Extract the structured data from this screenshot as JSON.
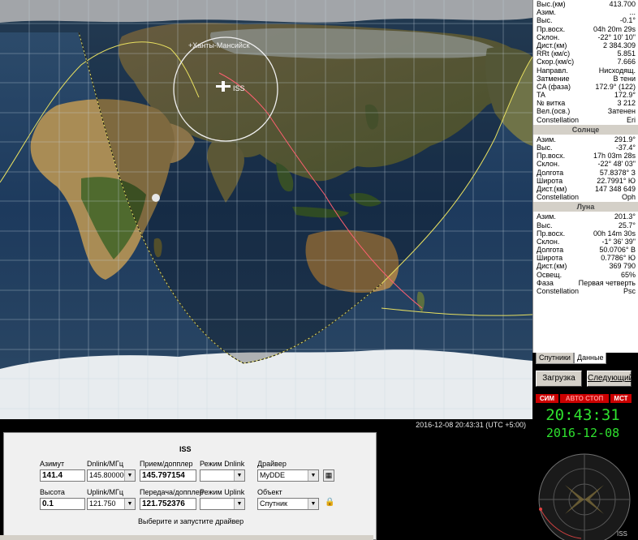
{
  "map": {
    "status": "2016-12-08 20:43:31 (UTC +5:00)",
    "sat_label": "ISS",
    "city_label": "+Ханты-Мансийск"
  },
  "info_main": [
    [
      "Выс.(км)",
      "413.700"
    ],
    [
      "Азим.",
      "..."
    ],
    [
      "Выс.",
      "-0.1°"
    ],
    [
      "Пр.восх.",
      "04h 20m 29s"
    ],
    [
      "Склон.",
      "-22° 10' 10\""
    ],
    [
      "Дист.(км)",
      "2 384.309"
    ],
    [
      "RRt (км/с)",
      "5.851"
    ],
    [
      "Скор.(км/с)",
      "7.666"
    ],
    [
      "Направл.",
      "Нисходящ."
    ],
    [
      "Затмение",
      "В тени"
    ],
    [
      "CA (фаза)",
      "172.9° (122)"
    ],
    [
      "TA",
      "172.9°"
    ],
    [
      "№ витка",
      "3 212"
    ],
    [
      "Вел.(осв.)",
      "Затенен"
    ],
    [
      "Constellation",
      "Eri"
    ]
  ],
  "sun_title": "Солнце",
  "info_sun": [
    [
      "Азим.",
      "291.9°"
    ],
    [
      "Выс.",
      "-37.4°"
    ],
    [
      "Пр.восх.",
      "17h 03m 28s"
    ],
    [
      "Склон.",
      "-22° 48' 03\""
    ],
    [
      "Долгота",
      "57.8378° З"
    ],
    [
      "Широта",
      "22.7991° Ю"
    ],
    [
      "Дист.(км)",
      "147 348 649"
    ],
    [
      "Constellation",
      "Oph"
    ]
  ],
  "moon_title": "Луна",
  "info_moon": [
    [
      "Азим.",
      "201.3°"
    ],
    [
      "Выс.",
      "25.7°"
    ],
    [
      "Пр.восх.",
      "00h 14m 30s"
    ],
    [
      "Склон.",
      "-1° 36' 39\""
    ],
    [
      "Долгота",
      "50.0706° В"
    ],
    [
      "Широта",
      "0.7786° Ю"
    ],
    [
      "Дист.(км)",
      "369 790"
    ],
    [
      "Освещ.",
      "65%"
    ],
    [
      "Фаза",
      "Первая четверть"
    ],
    [
      "Constellation",
      "Psc"
    ]
  ],
  "tabs": {
    "satellites": "Спутники",
    "data": "Данные"
  },
  "buttons": {
    "load_tle": "Загрузка TLE",
    "next": "Следующий"
  },
  "clock": {
    "tab1": "СИМ",
    "tab2": "АВТО СТОП",
    "tab3": "МСТ",
    "time": "20:43:31",
    "date": "2016-12-08"
  },
  "radar": {
    "sat_label": "ISS"
  },
  "driver": {
    "title": "ISS",
    "azimuth_label": "Азимут",
    "azimuth_value": "141.4",
    "elevation_label": "Высота",
    "elevation_value": "0.1",
    "dnlink_label": "Dnlink/МГц",
    "dnlink_value": "145.800000",
    "uplink_label": "Uplink/МГц",
    "uplink_value": "121.750",
    "rx_doppler_label": "Прием/допплер",
    "rx_doppler_value": "145.797154",
    "tx_doppler_label": "Передача/допплер",
    "tx_doppler_value": "121.752376",
    "mode_dn_label": "Режим Dnlink",
    "mode_dn_value": "",
    "mode_up_label": "Режим Uplink",
    "mode_up_value": "",
    "driver_label": "Драйвер",
    "driver_value": "MyDDE",
    "object_label": "Объект",
    "object_value": "Спутник",
    "hint": "Выберите и запустите драйвер"
  }
}
